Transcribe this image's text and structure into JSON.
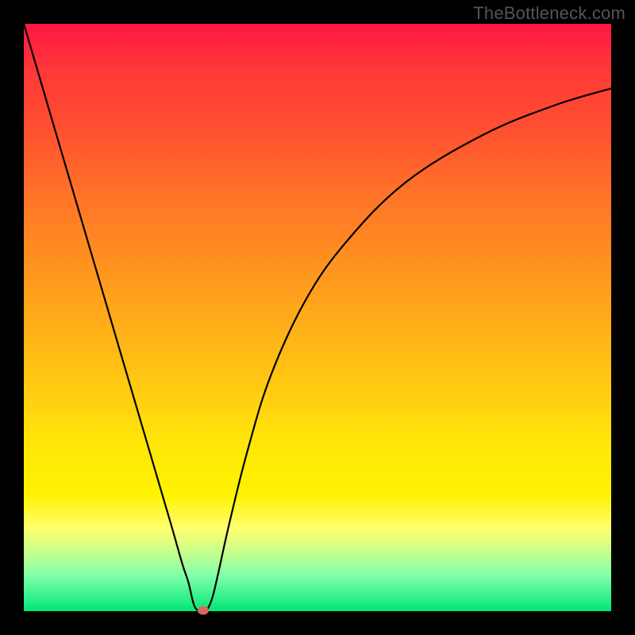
{
  "watermark": "TheBottleneck.com",
  "chart_data": {
    "type": "line",
    "title": "",
    "xlabel": "",
    "ylabel": "",
    "xlim": [
      0,
      100
    ],
    "ylim": [
      0,
      100
    ],
    "series": [
      {
        "name": "bottleneck-curve",
        "x": [
          0,
          5,
          10,
          15,
          20,
          25,
          27,
          28,
          29,
          30,
          31,
          32,
          33,
          35,
          38,
          42,
          48,
          55,
          65,
          78,
          90,
          100
        ],
        "values": [
          100,
          83,
          66,
          49,
          32,
          15,
          8,
          5,
          1,
          0,
          0,
          2,
          6,
          15,
          27,
          40,
          53,
          63,
          73,
          81,
          86,
          89
        ]
      }
    ],
    "marker": {
      "x": 30.5,
      "y": 0.2,
      "color": "#d9695c"
    },
    "gradient_stops": [
      {
        "pos": 0,
        "color": "#ff1744"
      },
      {
        "pos": 100,
        "color": "#00e676"
      }
    ]
  }
}
